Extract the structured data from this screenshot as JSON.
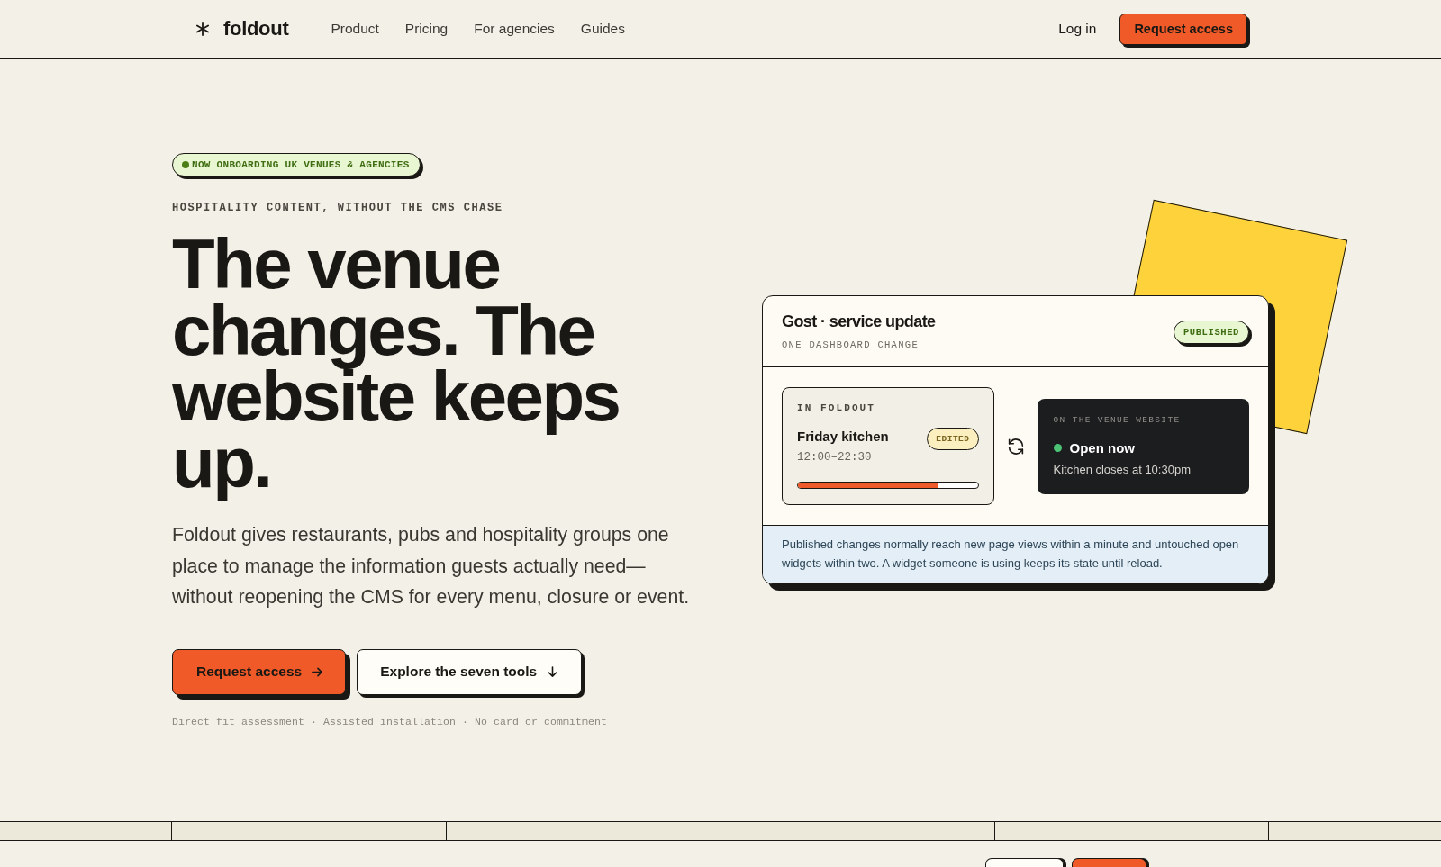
{
  "nav": {
    "brand": "foldout",
    "links": [
      {
        "label": "Product"
      },
      {
        "label": "Pricing"
      },
      {
        "label": "For agencies"
      },
      {
        "label": "Guides"
      }
    ],
    "login": "Log in",
    "cta": "Request access"
  },
  "hero": {
    "badge": "NOW ONBOARDING UK VENUES & AGENCIES",
    "eyebrow": "HOSPITALITY CONTENT, WITHOUT THE CMS CHASE",
    "heading": "The venue changes. The website keeps up.",
    "lede": "Foldout gives restaurants, pubs and hospitality groups one place to manage the information guests actually need—without reopening the CMS for every menu, closure or event.",
    "buttons": [
      {
        "label": "Request access",
        "kind": "primary"
      },
      {
        "label": "Explore the seven tools",
        "kind": "secondary"
      }
    ],
    "footnote": "Direct fit assessment · Assisted installation · No card or commitment"
  },
  "preview_card": {
    "title": "Gost · service update",
    "subtitle": "ONE DASHBOARD CHANGE",
    "status": "PUBLISHED",
    "source": {
      "label": "IN FOLDOUT",
      "item": "Friday kitchen",
      "badge": "EDITED",
      "hours": "12:00–22:30",
      "level": 0.78
    },
    "output": {
      "label": "ON THE VENUE WEBSITE",
      "status": "Open now",
      "detail": "Kitchen closes at 10:30pm"
    },
    "note": "Published changes normally reach new page views within a minute and untouched open widgets within two. A widget someone is using keeps its state until reload."
  }
}
